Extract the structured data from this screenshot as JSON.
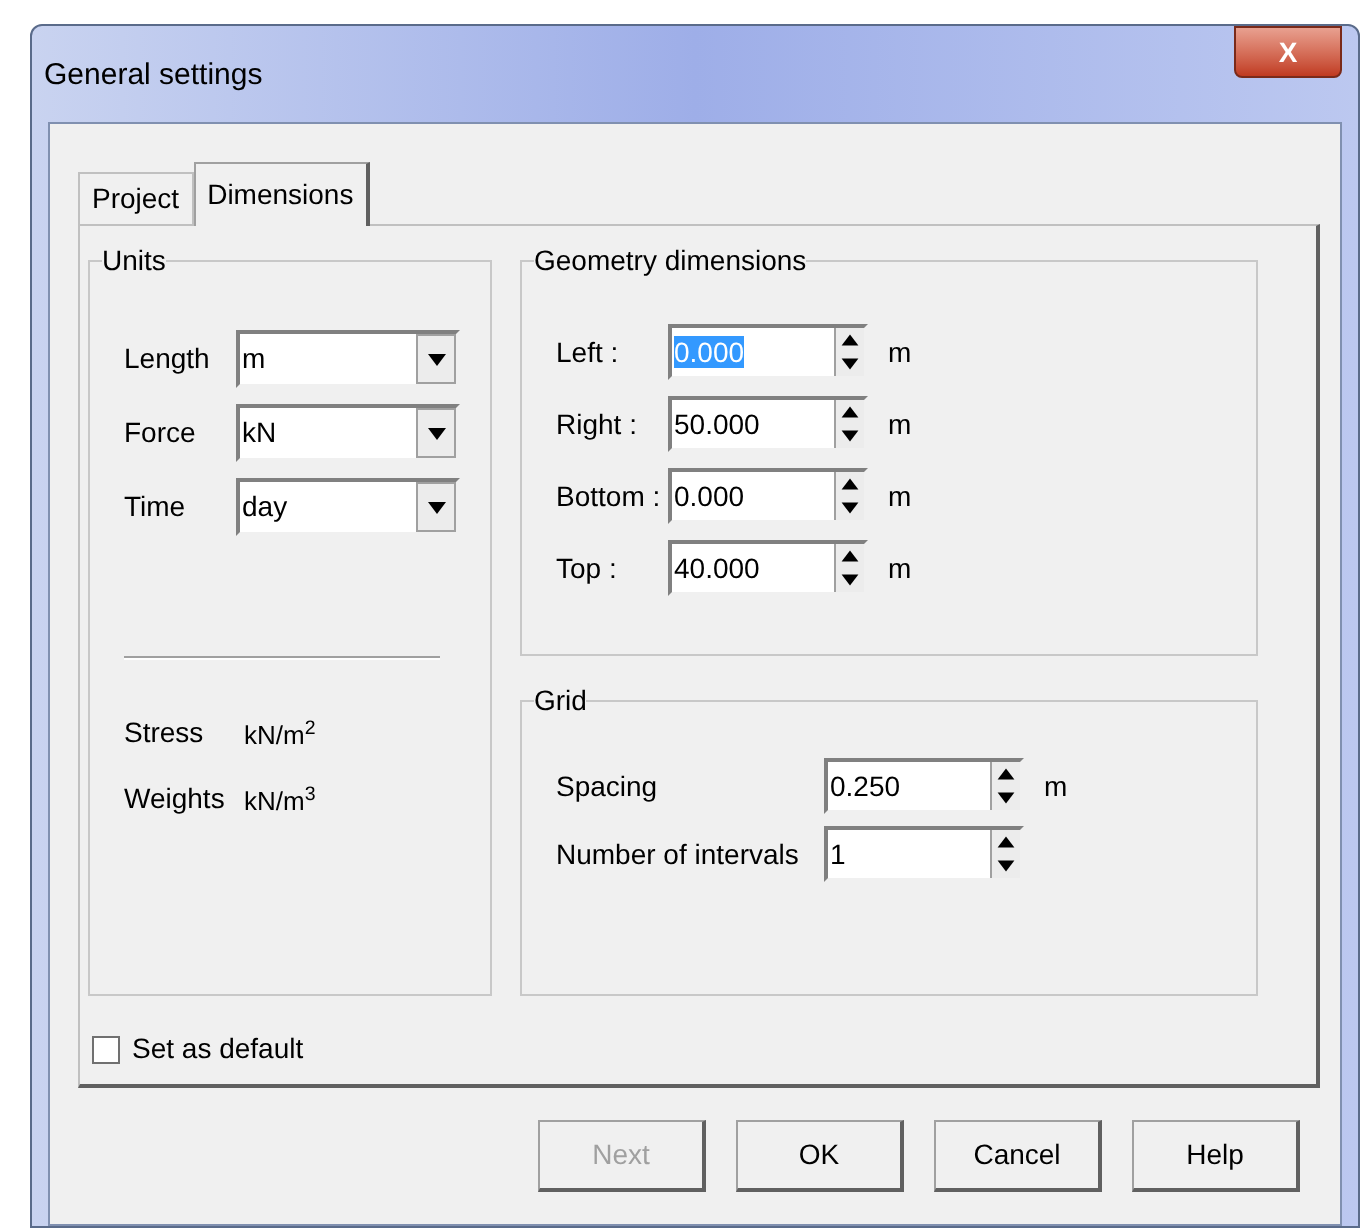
{
  "window": {
    "title": "General settings",
    "close_label": "X"
  },
  "tabs": [
    {
      "label": "Project",
      "selected": false
    },
    {
      "label": "Dimensions",
      "selected": true
    }
  ],
  "units": {
    "title": "Units",
    "rows": [
      {
        "label": "Length",
        "value": "m"
      },
      {
        "label": "Force",
        "value": "kN"
      },
      {
        "label": "Time",
        "value": "day"
      }
    ],
    "derived": [
      {
        "label": "Stress",
        "value": "kN/m$^{2}$"
      },
      {
        "label": "Weights",
        "value": "kN/m$^{3}$"
      }
    ]
  },
  "geometry": {
    "title": "Geometry dimensions",
    "rows": [
      {
        "label": "Left :",
        "value": "0.000",
        "unit": "m",
        "selected": true
      },
      {
        "label": "Right :",
        "value": "50.000",
        "unit": "m",
        "selected": false
      },
      {
        "label": "Bottom :",
        "value": "0.000",
        "unit": "m",
        "selected": false
      },
      {
        "label": "Top :",
        "value": "40.000",
        "unit": "m",
        "selected": false
      }
    ]
  },
  "grid": {
    "title": "Grid",
    "rows": [
      {
        "label": "Spacing",
        "value": "0.250",
        "unit": "m"
      },
      {
        "label": "Number of intervals",
        "value": "1"
      }
    ]
  },
  "set_as_default": {
    "label": "Set as default",
    "checked": false
  },
  "buttons": [
    {
      "label": "Next",
      "disabled": true
    },
    {
      "label": "OK",
      "disabled": false
    },
    {
      "label": "Cancel",
      "disabled": false
    },
    {
      "label": "Help",
      "disabled": false
    }
  ]
}
